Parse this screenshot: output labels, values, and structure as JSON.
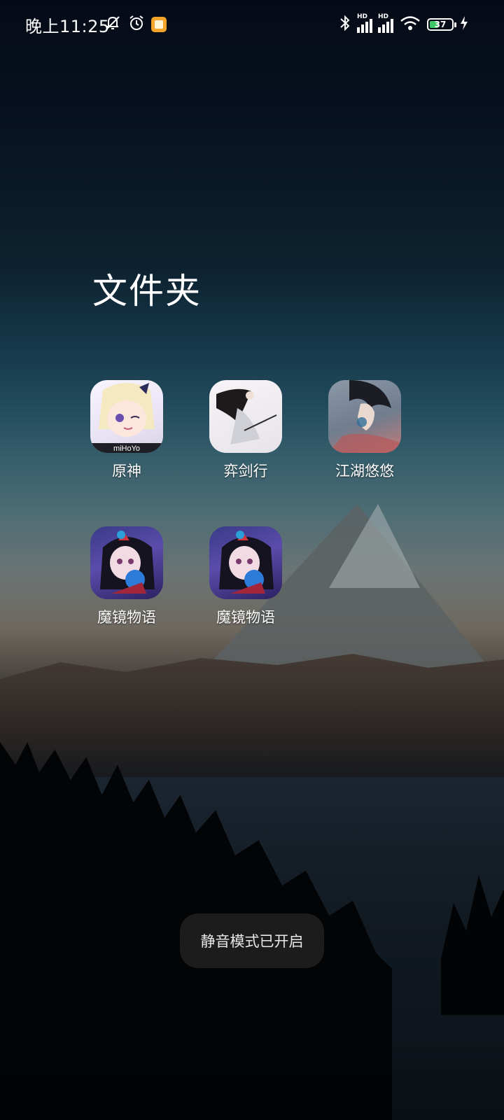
{
  "status_bar": {
    "time": "晚上11:25",
    "battery_level": "37",
    "icons": [
      "bell-off-icon",
      "alarm-icon",
      "notification-app-icon",
      "bluetooth-icon",
      "signal-hd-1-icon",
      "signal-hd-2-icon",
      "wifi-icon",
      "battery-icon",
      "charging-icon"
    ]
  },
  "folder": {
    "title": "文件夹",
    "apps": [
      {
        "label": "原神",
        "icon": "yuanshen-app-icon",
        "icon_text": "miHoYo"
      },
      {
        "label": "弈剑行",
        "icon": "yijianxing-app-icon"
      },
      {
        "label": "江湖悠悠",
        "icon": "jianghuyouyou-app-icon"
      },
      {
        "label": "魔镜物语",
        "icon": "mojingwuyu-app-icon"
      },
      {
        "label": "魔镜物语",
        "icon": "mojingwuyu-app-icon"
      }
    ]
  },
  "toast": {
    "message": "静音模式已开启"
  },
  "colors": {
    "battery_fill": "#3ec86a",
    "notification_badge": "#f4a52a",
    "toast_bg": "#1e1e20"
  }
}
